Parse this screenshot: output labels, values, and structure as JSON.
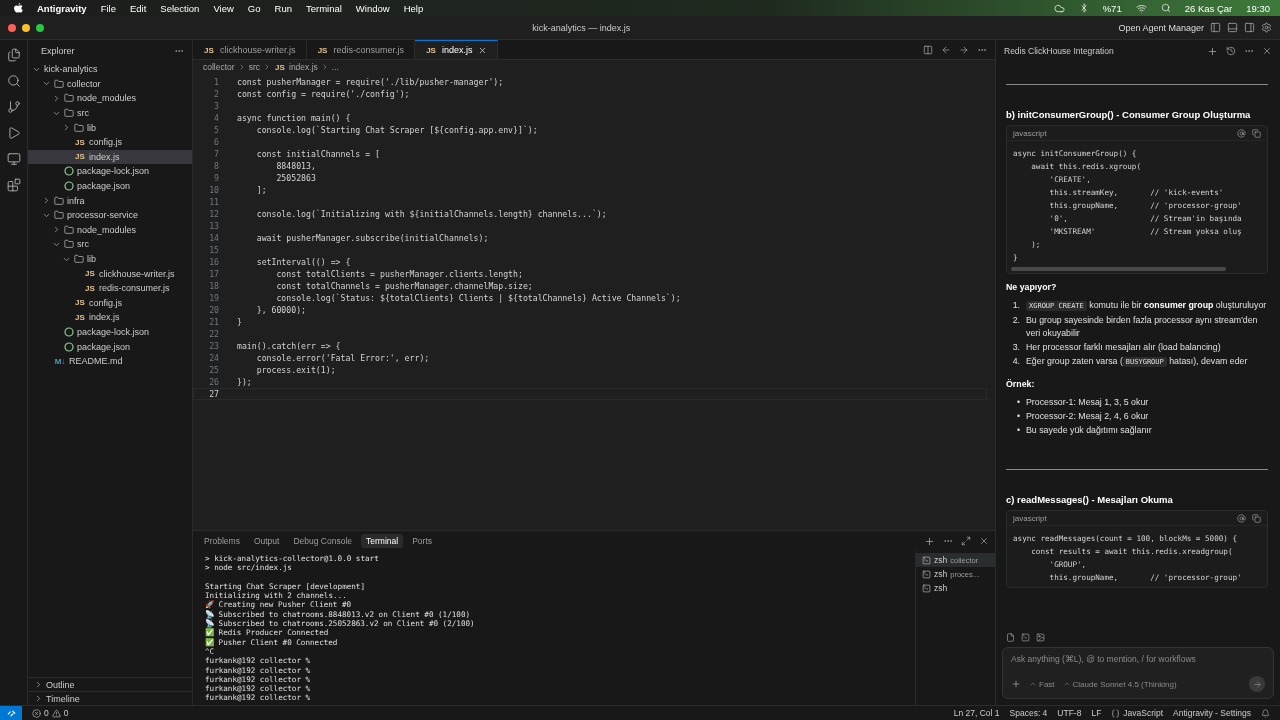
{
  "menu_bar": {
    "app": "Antigravity",
    "menus": [
      "File",
      "Edit",
      "Selection",
      "View",
      "Go",
      "Run",
      "Terminal",
      "Window",
      "Help"
    ],
    "battery": "%71",
    "date": "26 Kas Çar",
    "time": "19:30"
  },
  "title_bar": {
    "title": "kick-analytics — index.js",
    "agent_manager": "Open Agent Manager"
  },
  "explorer": {
    "title": "Explorer",
    "tree": [
      {
        "label": "kick-analytics",
        "kind": "root",
        "expanded": true,
        "selected": false,
        "children": [
          {
            "label": "collector",
            "kind": "folder",
            "expanded": true,
            "selected": false,
            "children": [
              {
                "label": "node_modules",
                "kind": "folder",
                "expanded": false,
                "selected": false
              },
              {
                "label": "src",
                "kind": "folder",
                "expanded": true,
                "selected": false,
                "children": [
                  {
                    "label": "lib",
                    "kind": "folder",
                    "expanded": false,
                    "selected": false
                  },
                  {
                    "label": "config.js",
                    "kind": "js",
                    "icon": "JS",
                    "selected": false
                  },
                  {
                    "label": "index.js",
                    "kind": "js",
                    "icon": "JS",
                    "selected": true
                  }
                ]
              },
              {
                "label": "package-lock.json",
                "kind": "json",
                "selected": false
              },
              {
                "label": "package.json",
                "kind": "json",
                "selected": false
              }
            ]
          },
          {
            "label": "infra",
            "kind": "folder",
            "expanded": false,
            "selected": false
          },
          {
            "label": "processor-service",
            "kind": "folder",
            "expanded": true,
            "selected": false,
            "children": [
              {
                "label": "node_modules",
                "kind": "folder",
                "expanded": false,
                "selected": false
              },
              {
                "label": "src",
                "kind": "folder",
                "expanded": true,
                "selected": false,
                "children": [
                  {
                    "label": "lib",
                    "kind": "folder",
                    "expanded": true,
                    "selected": false,
                    "children": [
                      {
                        "label": "clickhouse-writer.js",
                        "kind": "js",
                        "icon": "JS",
                        "selected": false
                      },
                      {
                        "label": "redis-consumer.js",
                        "kind": "js",
                        "icon": "JS",
                        "selected": false
                      }
                    ]
                  },
                  {
                    "label": "config.js",
                    "kind": "js",
                    "icon": "JS",
                    "selected": false
                  },
                  {
                    "label": "index.js",
                    "kind": "js",
                    "icon": "JS",
                    "selected": false
                  }
                ]
              },
              {
                "label": "package-lock.json",
                "kind": "json",
                "selected": false
              },
              {
                "label": "package.json",
                "kind": "json",
                "selected": false
              }
            ]
          },
          {
            "label": "README.md",
            "kind": "md",
            "icon": "M↓",
            "selected": false
          }
        ]
      }
    ],
    "sections": [
      {
        "label": "Outline",
        "expanded": false
      },
      {
        "label": "Timeline",
        "expanded": false
      }
    ]
  },
  "editor": {
    "tabs": [
      {
        "label": "clickhouse-writer.js",
        "icon": "JS",
        "selected": false
      },
      {
        "label": "redis-consumer.js",
        "icon": "JS",
        "selected": false
      },
      {
        "label": "index.js",
        "icon": "JS",
        "selected": true
      }
    ],
    "breadcrumb": [
      {
        "label": "collector"
      },
      {
        "label": "src"
      },
      {
        "label": "index.js",
        "icon": "JS"
      },
      {
        "label": "..."
      }
    ],
    "lines": [
      {
        "n": "1",
        "text": "const pusherManager = require('./lib/pusher-manager');",
        "current": false
      },
      {
        "n": "2",
        "text": "const config = require('./config');",
        "current": false
      },
      {
        "n": "3",
        "current": false
      },
      {
        "n": "4",
        "text": "async function main() {",
        "current": false
      },
      {
        "n": "5",
        "text": "    console.log(`Starting Chat Scraper [${config.app.env}]`);",
        "current": false
      },
      {
        "n": "6",
        "current": false
      },
      {
        "n": "7",
        "text": "    const initialChannels = [",
        "current": false
      },
      {
        "n": "8",
        "text": "        8848013,",
        "current": false
      },
      {
        "n": "9",
        "text": "        25052863",
        "current": false
      },
      {
        "n": "10",
        "text": "    ];",
        "current": false
      },
      {
        "n": "11",
        "current": false
      },
      {
        "n": "12",
        "text": "    console.log(`Initializing with ${initialChannels.length} channels...`);",
        "current": false
      },
      {
        "n": "13",
        "current": false
      },
      {
        "n": "14",
        "text": "    await pusherManager.subscribe(initialChannels);",
        "current": false
      },
      {
        "n": "15",
        "current": false
      },
      {
        "n": "16",
        "text": "    setInterval(() => {",
        "current": false
      },
      {
        "n": "17",
        "text": "        const totalClients = pusherManager.clients.length;",
        "current": false
      },
      {
        "n": "18",
        "text": "        const totalChannels = pusherManager.channelMap.size;",
        "current": false
      },
      {
        "n": "19",
        "text": "        console.log(`Status: ${totalClients} Clients | ${totalChannels} Active Channels`);",
        "current": false
      },
      {
        "n": "20",
        "text": "    }, 60000);",
        "current": false
      },
      {
        "n": "21",
        "text": "}",
        "current": false
      },
      {
        "n": "22",
        "current": false
      },
      {
        "n": "23",
        "text": "main().catch(err => {",
        "current": false
      },
      {
        "n": "24",
        "text": "    console.error('Fatal Error:', err);",
        "current": false
      },
      {
        "n": "25",
        "text": "    process.exit(1);",
        "current": false
      },
      {
        "n": "26",
        "text": "});",
        "current": false
      },
      {
        "n": "27",
        "current": true
      }
    ]
  },
  "panel": {
    "tabs": [
      {
        "label": "Problems",
        "selected": false
      },
      {
        "label": "Output",
        "selected": false
      },
      {
        "label": "Debug Console",
        "selected": false
      },
      {
        "label": "Terminal",
        "selected": true
      },
      {
        "label": "Ports",
        "selected": false
      }
    ],
    "terminal_blocks": [
      [
        "> kick-analytics-collector@1.0.0 start",
        "> node src/index.js"
      ],
      [
        "Starting Chat Scraper [development]",
        "Initializing with 2 channels...",
        "🚀 Creating new Pusher Client #0",
        "📡 Subscribed to chatrooms.8848013.v2 on Client #0 (1/100)",
        "📡 Subscribed to chatrooms.25052863.v2 on Client #0 (2/100)",
        "✅ Redis Producer Connected",
        "✅ Pusher Client #0 Connected",
        "^C",
        "furkank@192 collector %",
        "furkank@192 collector %",
        "furkank@192 collector %",
        "furkank@192 collector %",
        "furkank@192 collector %"
      ]
    ],
    "sessions": [
      {
        "shell": "zsh",
        "name": "collector",
        "selected": true
      },
      {
        "shell": "zsh",
        "name": "proces...",
        "selected": false
      },
      {
        "shell": "zsh",
        "selected": false
      }
    ]
  },
  "agent": {
    "title": "Redis ClickHouse Integration",
    "blocks": [
      {
        "kind": "divider"
      },
      {
        "kind": "heading",
        "text": "b) initConsumerGroup() - Consumer Group Oluşturma"
      },
      {
        "kind": "code",
        "language": "javascript",
        "scroll": true,
        "lines": [
          "async initConsumerGroup() {",
          "    await this.redis.xgroup(",
          "        'CREATE',",
          "        this.streamKey,       // 'kick-events'",
          "        this.groupName,       // 'processor-group'",
          "        '0',                  // Stream'in başında",
          "        'MKSTREAM'            // Stream yoksa oluş",
          "    );",
          "}"
        ]
      },
      {
        "kind": "label",
        "text": "Ne yapıyor?"
      },
      {
        "kind": "list",
        "items": [
          {
            "marker": "1.",
            "parts": [
              {
                "kind": "code",
                "text": "XGROUP CREATE"
              },
              {
                "kind": "text",
                "text": " komutu ile bir "
              },
              {
                "kind": "bold",
                "text": "consumer group"
              },
              {
                "kind": "text",
                "text": " oluşturuluyor"
              }
            ]
          },
          {
            "marker": "2.",
            "parts": [
              {
                "kind": "text",
                "text": "Bu group sayesinde birden fazla processor aynı stream'den veri okuyabilir"
              }
            ]
          },
          {
            "marker": "3.",
            "parts": [
              {
                "kind": "text",
                "text": "Her processor farklı mesajları alır (load balancing)"
              }
            ]
          },
          {
            "marker": "4.",
            "parts": [
              {
                "kind": "text",
                "text": "Eğer group zaten varsa ("
              },
              {
                "kind": "code",
                "text": "BUSYGROUP"
              },
              {
                "kind": "text",
                "text": " hatası), devam eder"
              }
            ]
          }
        ]
      },
      {
        "kind": "label",
        "text": "Örnek:"
      },
      {
        "kind": "list",
        "items": [
          {
            "marker": "•",
            "parts": [
              {
                "kind": "text",
                "text": "Processor-1: Mesaj 1, 3, 5 okur"
              }
            ]
          },
          {
            "marker": "•",
            "parts": [
              {
                "kind": "text",
                "text": "Processor-2: Mesaj 2, 4, 6 okur"
              }
            ]
          },
          {
            "marker": "•",
            "parts": [
              {
                "kind": "text",
                "text": "Bu sayede yük dağıtımı sağlanır"
              }
            ]
          }
        ]
      },
      {
        "kind": "divider"
      },
      {
        "kind": "heading",
        "text": "c) readMessages() - Mesajları Okuma"
      },
      {
        "kind": "code",
        "language": "javascript",
        "scroll": false,
        "lines": [
          "async readMessages(count = 100, blockMs = 5000) {",
          "    const results = await this.redis.xreadgroup(",
          "        'GROUP',",
          "        this.groupName,       // 'processor-group'"
        ]
      }
    ],
    "input": {
      "placeholder": "Ask anything (⌘L), @ to mention, / for workflows"
    },
    "mode": "Fast",
    "model": "Claude Sonnet 4.5 (Thinking)"
  },
  "status_bar": {
    "errors": "0",
    "warnings": "0",
    "position": "Ln 27, Col 1",
    "spaces": "Spaces: 4",
    "encoding": "UTF-8",
    "eol": "LF",
    "language": "JavaScript",
    "settings": "Antigravity - Settings"
  }
}
